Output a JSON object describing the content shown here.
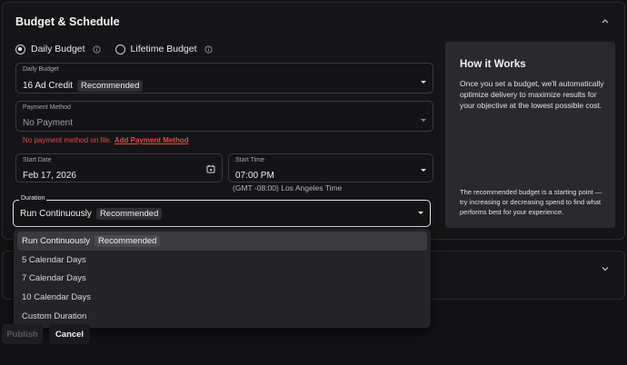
{
  "section": {
    "title": "Budget & Schedule"
  },
  "budget_type": {
    "options": [
      {
        "label": "Daily Budget",
        "selected": true
      },
      {
        "label": "Lifetime Budget",
        "selected": false
      }
    ]
  },
  "daily_budget": {
    "label": "Daily Budget",
    "value": "16 Ad Credit",
    "badge": "Recommended"
  },
  "payment_method": {
    "label": "Payment Method",
    "value": "No Payment",
    "error": "No payment method on file.",
    "error_link": "Add Payment Method"
  },
  "start_date": {
    "label": "Start Date",
    "value": "Feb 17, 2026"
  },
  "start_time": {
    "label": "Start Time",
    "value": "07:00 PM",
    "timezone": "(GMT -08:00) Los Angeles Time"
  },
  "duration": {
    "label": "Duration",
    "value": "Run Continuously",
    "badge": "Recommended",
    "options": [
      {
        "label": "Run Continuously",
        "badge": "Recommended",
        "selected": true
      },
      {
        "label": "5 Calendar Days"
      },
      {
        "label": "7 Calendar Days"
      },
      {
        "label": "10 Calendar Days"
      },
      {
        "label": "Custom Duration"
      }
    ]
  },
  "how_it_works": {
    "title": "How it Works",
    "body": "Once you set a budget, we'll automatically optimize delivery to maximize results for your objective at the lowest possible cost.",
    "footer": "The recommended budget is a starting point — try increasing or decreasing spend to find what performs best for your experience."
  },
  "actions": {
    "publish": "Publish",
    "cancel": "Cancel"
  },
  "colors": {
    "error": "#e5484d",
    "background": "#121214",
    "panel": "#2a2a2e"
  }
}
